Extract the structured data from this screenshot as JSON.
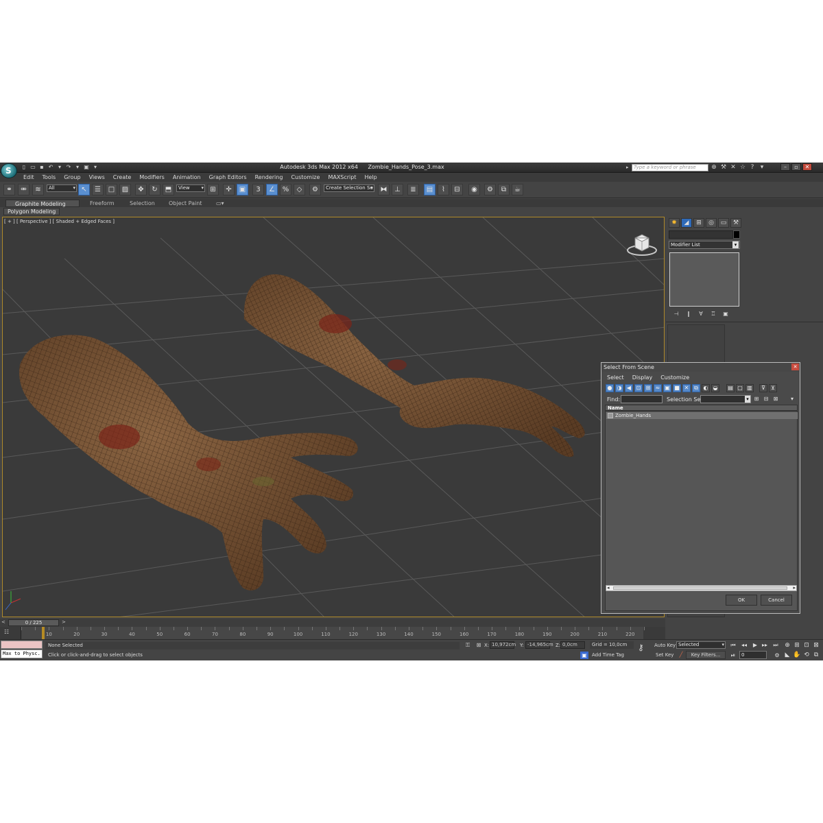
{
  "app": {
    "name": "Autodesk 3ds Max  2012 x64",
    "file": "Zombie_Hands_Pose_3.max",
    "search_placeholder": "Type a keyword or phrase"
  },
  "quick_access": [
    "new-icon",
    "open-icon",
    "save-icon",
    "undo-icon",
    "redo-icon",
    "project-icon"
  ],
  "menu": [
    "Edit",
    "Tools",
    "Group",
    "Views",
    "Create",
    "Modifiers",
    "Animation",
    "Graph Editors",
    "Rendering",
    "Customize",
    "MAXScript",
    "Help"
  ],
  "toolbar": {
    "selection_filter": "All",
    "reference_coord": "View",
    "named_selection": "Create Selection Se",
    "snap_toggle": "3",
    "angle_snap": "2",
    "percent_snap": "%"
  },
  "ribbon": {
    "tabs": [
      "Graphite Modeling Tools",
      "Freeform",
      "Selection",
      "Object Paint"
    ],
    "panel": "Polygon Modeling"
  },
  "viewport": {
    "label": "[ + ] [ Perspective ] [ Shaded + Edged Faces ]"
  },
  "command_panel": {
    "modifier_list": "Modifier List"
  },
  "dialog": {
    "title": "Select From Scene",
    "menu": [
      "Select",
      "Display",
      "Customize"
    ],
    "find_label": "Find:",
    "selection_set_label": "Selection Set:",
    "column_name": "Name",
    "items": [
      "Zombie_Hands"
    ],
    "ok": "OK",
    "cancel": "Cancel"
  },
  "timeline": {
    "current": "0 / 225",
    "prev": "<",
    "next": ">",
    "ruler": [
      "10",
      "20",
      "30",
      "40",
      "50",
      "60",
      "70",
      "80",
      "90",
      "100",
      "110",
      "120",
      "130",
      "140",
      "150",
      "160",
      "170",
      "180",
      "190",
      "200",
      "210",
      "220"
    ]
  },
  "status": {
    "maxscript": "Max to Physc.",
    "selection": "None Selected",
    "prompt": "Click or click-and-drag to select objects",
    "x_label": "X:",
    "x_value": "10,972cm",
    "y_label": "Y:",
    "y_value": "-14,965cm",
    "z_label": "Z:",
    "z_value": "0,0cm",
    "grid": "Grid = 10,0cm",
    "add_time_tag": "Add Time Tag",
    "auto_key": "Auto Key",
    "set_key": "Set Key",
    "key_mode": "Selected",
    "key_filters": "Key Filters...",
    "frame": "0"
  },
  "colors": {
    "viewport_border": "#b08a2a",
    "active_tool": "#5a8fd0",
    "skin": "#7a5636",
    "wound": "#8a2a1c"
  }
}
